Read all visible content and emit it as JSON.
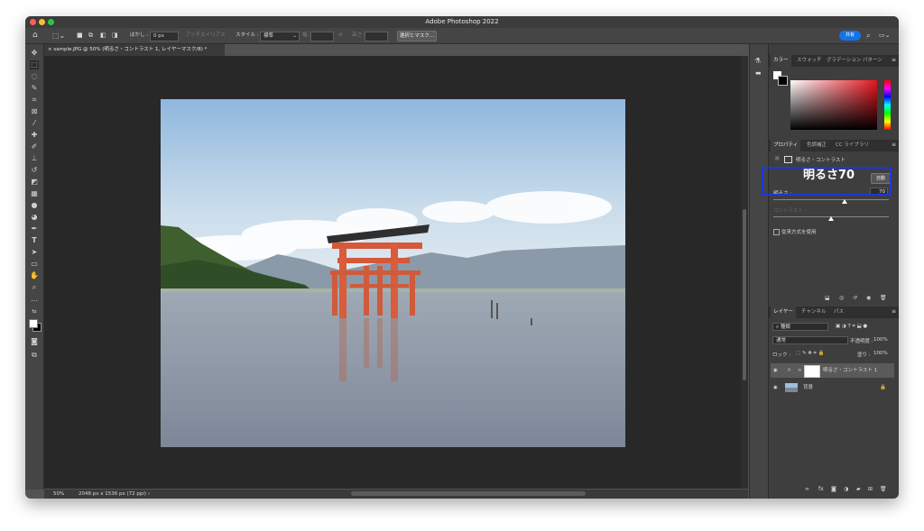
{
  "app": {
    "title": "Adobe Photoshop 2022",
    "traffic_lights": {
      "close": "#ff5f57",
      "minimize": "#febc2e",
      "zoom": "#28c840"
    }
  },
  "options_bar": {
    "home_icon": "home-icon",
    "feather_label": "ぼかし :",
    "feather_value": "0 px",
    "antialias_label": "アンチエイリアス",
    "style_label": "スタイル :",
    "style_value": "標準",
    "width_label": "幅 :",
    "height_label": "高さ :",
    "select_mask_label": "選択とマスク...",
    "share_label": "共有",
    "accent": "#1473e6"
  },
  "document": {
    "tab_title": "sample.JPG @ 50% (明るさ・コントラスト 1, レイヤーマスク/8) *",
    "zoom": "50%",
    "info": "2048 px x 1536 px (72 ppi)"
  },
  "color_panel": {
    "tabs": [
      "カラー",
      "スウォッチ",
      "グラデーション",
      "パターン"
    ]
  },
  "properties_panel": {
    "tabs": [
      "プロパティ",
      "色調補正",
      "CC ライブラリ"
    ],
    "adjustment_title": "明るさ・コントラスト",
    "overlay_caption": "明るさ70",
    "auto_label": "自動",
    "brightness_label": "明るさ :",
    "brightness_value": "70",
    "brightness_fraction": 0.62,
    "contrast_label": "コントラスト :",
    "contrast_value": "0",
    "contrast_fraction": 0.5,
    "legacy_label": "従来方式を使用",
    "highlight_color": "#1a37e0"
  },
  "layers_panel": {
    "tabs": [
      "レイヤー",
      "チャンネル",
      "パス"
    ],
    "filter_label": "種類",
    "blend_mode": "通常",
    "opacity_label": "不透明度 :",
    "opacity_value": "100%",
    "lock_label": "ロック :",
    "fill_label": "塗り :",
    "fill_value": "100%",
    "layers": [
      {
        "name": "明るさ・コントラスト 1",
        "selected": true
      },
      {
        "name": "背景",
        "selected": false
      }
    ]
  }
}
